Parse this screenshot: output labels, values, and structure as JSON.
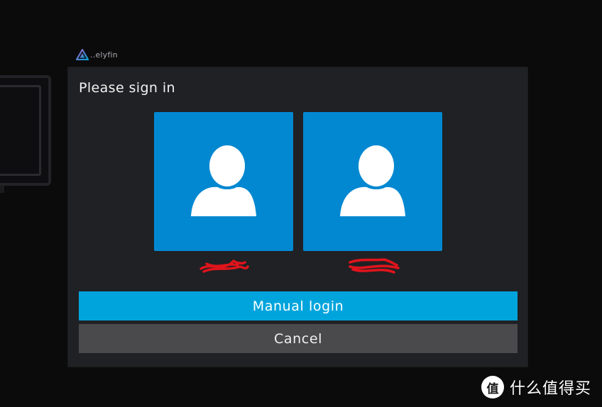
{
  "app": {
    "logo_text": "..elyfin"
  },
  "dialog": {
    "title": "Please sign in",
    "users": [
      {
        "name": ""
      },
      {
        "name": ""
      }
    ],
    "buttons": {
      "manual_login": "Manual login",
      "cancel": "Cancel"
    }
  },
  "watermark": {
    "text": "什么值得买",
    "badge": "值"
  },
  "colors": {
    "tile": "#0288d1",
    "primary": "#00a4dc",
    "cancel": "#4a4a4c",
    "dialog_bg": "#202124",
    "redaction": "#e0141c"
  },
  "icons": {
    "user": "user-avatar-icon",
    "logo": "jellyfin-logo-icon"
  }
}
